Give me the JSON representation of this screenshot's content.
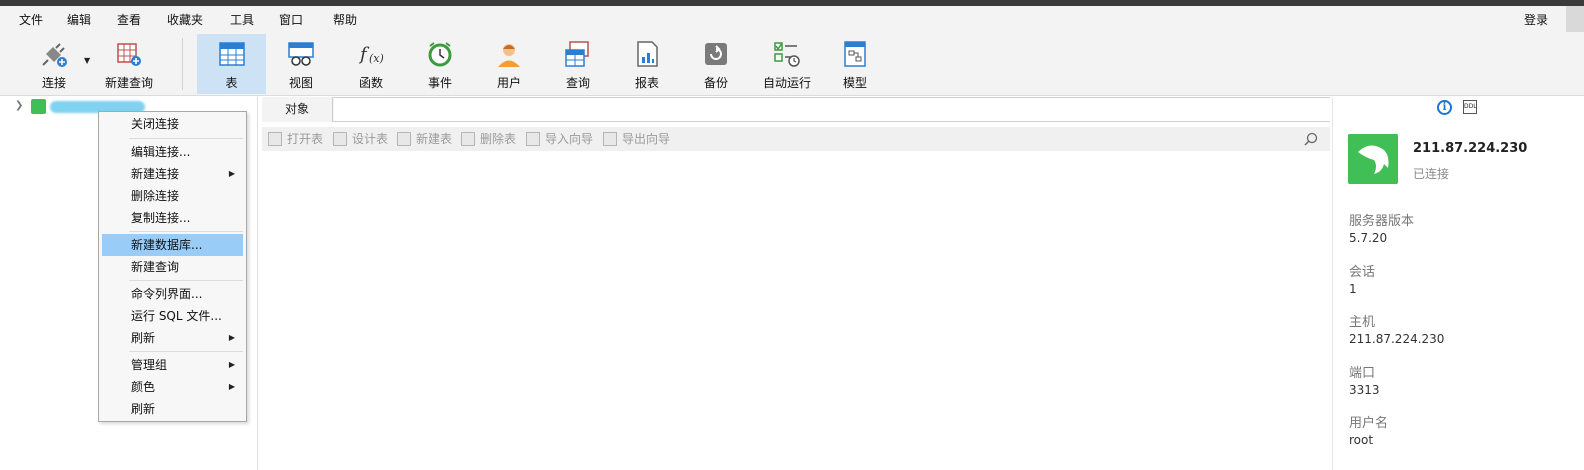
{
  "menu": [
    "文件",
    "编辑",
    "查看",
    "收藏夹",
    "工具",
    "窗口",
    "帮助"
  ],
  "login": "登录",
  "toolbar": {
    "connect": "连接",
    "new_query": "新建查询",
    "table": "表",
    "view": "视图",
    "function": "函数",
    "event": "事件",
    "user": "用户",
    "query": "查询",
    "report": "报表",
    "backup": "备份",
    "automation": "自动运行",
    "model": "模型",
    "active": "表"
  },
  "context_menu": {
    "items": [
      "关闭连接",
      "编辑连接...",
      "新建连接",
      "删除连接",
      "复制连接...",
      "新建数据库...",
      "新建查询",
      "命令列界面...",
      "运行 SQL 文件...",
      "刷新",
      "管理组",
      "颜色",
      "刷新"
    ],
    "highlighted": "新建数据库..."
  },
  "tabs": {
    "objects": "对象"
  },
  "object_toolbar": [
    "打开表",
    "设计表",
    "新建表",
    "删除表",
    "导入向导",
    "导出向导"
  ],
  "info_panel": {
    "host": "211.87.224.230",
    "status": "已连接",
    "ddl_label": "DDL",
    "props": [
      {
        "key": "服务器版本",
        "value": "5.7.20"
      },
      {
        "key": "会话",
        "value": "1"
      },
      {
        "key": "主机",
        "value": "211.87.224.230"
      },
      {
        "key": "端口",
        "value": "3313"
      },
      {
        "key": "用户名",
        "value": "root"
      }
    ]
  },
  "colors": {
    "accent_green": "#3fbf55",
    "highlight_blue": "#99ccf7",
    "active_tool": "#cde3f5",
    "info_blue": "#1a73d9"
  }
}
